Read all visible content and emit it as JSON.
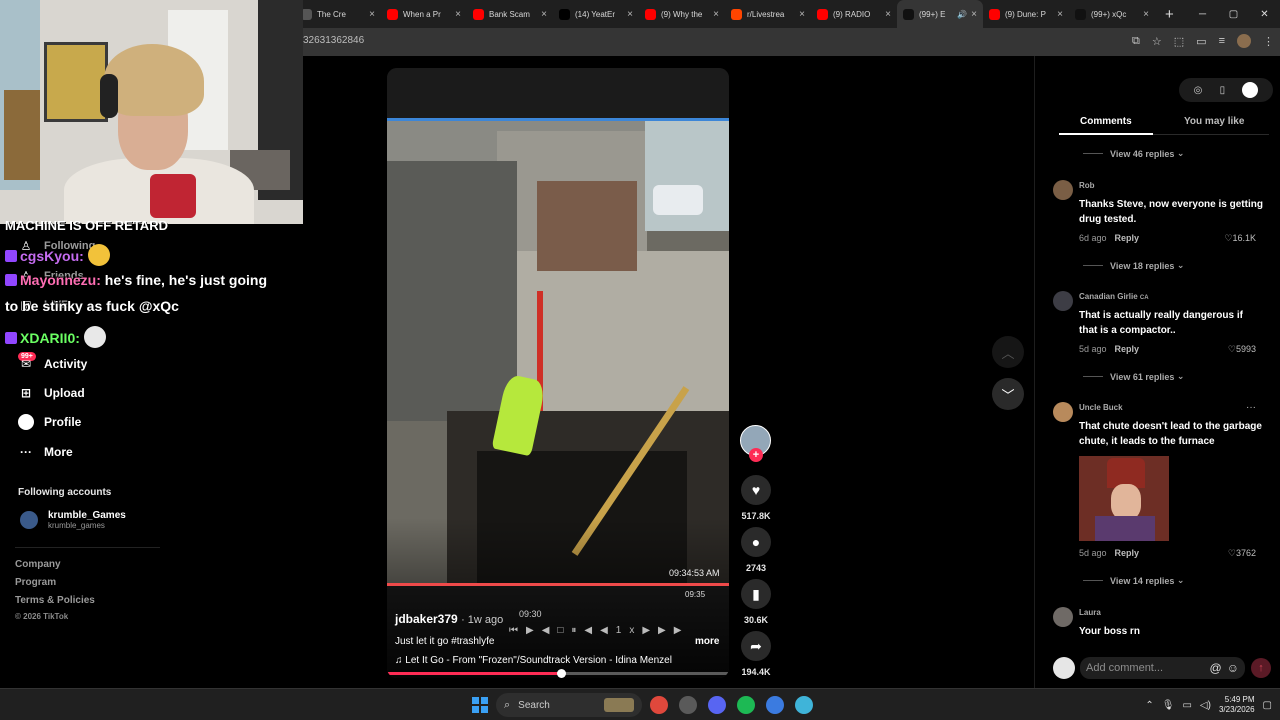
{
  "browser": {
    "tabs": [
      {
        "title": "The Cre",
        "favicon": "generic",
        "color": "#555555"
      },
      {
        "title": "When a Pr",
        "favicon": "youtube",
        "color": "#ff0000"
      },
      {
        "title": "Bank Scam",
        "favicon": "youtube",
        "color": "#ff0000"
      },
      {
        "title": "(14) YeatEr",
        "favicon": "x",
        "color": "#000000"
      },
      {
        "title": "(9) Why the",
        "favicon": "youtube",
        "color": "#ff0000"
      },
      {
        "title": "r/Livestrea",
        "favicon": "reddit",
        "color": "#ff4500"
      },
      {
        "title": "(9) RADIO",
        "favicon": "youtube",
        "color": "#ff0000"
      },
      {
        "title": "(99+) E",
        "favicon": "tiktok",
        "color": "#111111",
        "active": true
      },
      {
        "title": "(9) Dune: P",
        "favicon": "youtube",
        "color": "#ff0000"
      },
      {
        "title": "(99+) xQc",
        "favicon": "tiktok",
        "color": "#111111"
      }
    ],
    "url": "32631362846",
    "new_tab": "+",
    "window_controls": {
      "minimize": "─",
      "maximize": "▢",
      "close": "✕"
    }
  },
  "stream_overlay": {
    "top_message": "MACHINE IS OFF RETARD",
    "chat": [
      {
        "user": "cgsKyou:",
        "message": ""
      },
      {
        "user": "Mayonnezu:",
        "message": "he's fine, he's just going"
      },
      {
        "continuation": "to be stinky as fuck @xQc"
      },
      {
        "user": "XDARII0:",
        "message": ""
      }
    ]
  },
  "sidebar": {
    "following": "Following",
    "friends": "Friends",
    "live": "LIVE",
    "activity": "Activity",
    "activity_badge": "99+",
    "upload": "Upload",
    "profile": "Profile",
    "more": "More",
    "following_accounts_title": "Following accounts",
    "accounts": [
      {
        "name": "krumble_Games",
        "handle": "krumble_games"
      }
    ],
    "footer": [
      "Company",
      "Program",
      "Terms & Policies"
    ],
    "copyright": "© 2026 TikTok"
  },
  "video": {
    "author": "jdbaker379",
    "posted": "· 1w ago",
    "caption": "Just let it go #trashlyfe",
    "more_label": "more",
    "music": "Let It Go - From \"Frozen\"/Soundtrack Version - Idina Menzel",
    "overlay_timestamps": [
      "09:34:53 AM",
      "09:35",
      "09:30"
    ],
    "progress": 0.51
  },
  "actions": {
    "likes": "517.8K",
    "comments": "2743",
    "saves": "30.6K",
    "shares": "194.4K"
  },
  "comments_panel": {
    "tabs": [
      "Comments",
      "You may like"
    ],
    "top_replies": "View 46 replies",
    "comments": [
      {
        "user": "Rob",
        "text": "Thanks Steve, now everyone is getting drug tested.",
        "age": "6d ago",
        "reply": "Reply",
        "likes": "16.1K",
        "replies": "View 18 replies"
      },
      {
        "user": "Canadian Girlie",
        "flag": "CA",
        "text": "That is actually really dangerous if that is a compactor..",
        "age": "5d ago",
        "reply": "Reply",
        "likes": "5993",
        "replies": "View 61 replies"
      },
      {
        "user": "Uncle Buck",
        "text": "That chute doesn't lead to the garbage chute, it leads to the furnace",
        "age": "5d ago",
        "reply": "Reply",
        "likes": "3762",
        "replies": "View 14 replies"
      },
      {
        "user": "Laura",
        "text": "Your boss rn"
      }
    ],
    "add_comment_placeholder": "Add comment..."
  },
  "taskbar": {
    "search": "Search",
    "time": "5:49 PM",
    "date": "3/23/2026"
  }
}
